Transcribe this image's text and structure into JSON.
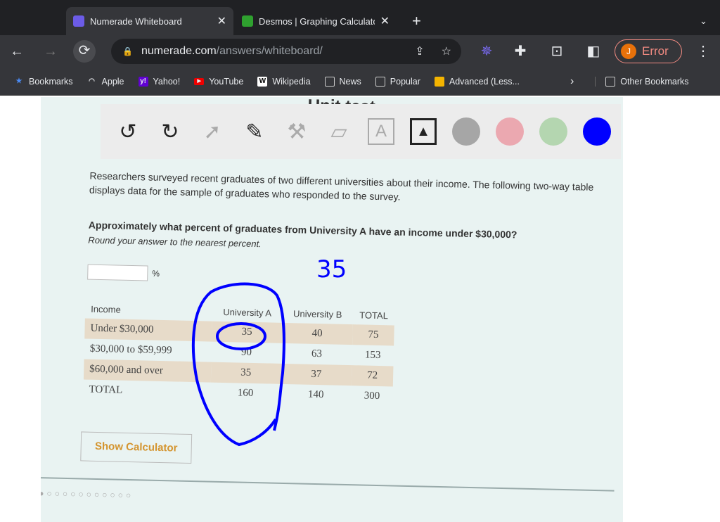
{
  "browser": {
    "tabs": [
      {
        "title": "Numerade Whiteboard",
        "active": true
      },
      {
        "title": "Desmos | Graphing Calculator",
        "active": false
      }
    ],
    "url_host": "numerade.com",
    "url_path": "/answers/whiteboard/",
    "profile": {
      "initial": "J",
      "label": "Error"
    },
    "bookmarks": [
      "Bookmarks",
      "Apple",
      "Yahoo!",
      "YouTube",
      "Wikipedia",
      "News",
      "Popular",
      "Advanced (Less..."
    ],
    "other_bookmarks": "Other Bookmarks"
  },
  "whiteboard": {
    "tools": [
      "undo",
      "redo",
      "pointer",
      "pen",
      "tools",
      "eraser",
      "text",
      "image"
    ],
    "colors": [
      "#a6a6a6",
      "#eba8b0",
      "#b4d6b0",
      "#0000ff"
    ],
    "heading_fragment": "Unit test",
    "handwritten_answer": "35"
  },
  "question": {
    "intro": "Researchers surveyed recent graduates of two different universities about their income. The following two-way table displays data for the sample of graduates who responded to the survey.",
    "prompt": "Approximately what percent of graduates from University A have an income under $30,000?",
    "hint": "Round your answer to the nearest percent.",
    "answer_value": "",
    "unit": "%",
    "table": {
      "headers": [
        "Income",
        "University A",
        "University B",
        "TOTAL"
      ],
      "rows": [
        [
          "Under $30,000",
          "35",
          "40",
          "75"
        ],
        [
          "$30,000 to $59,999",
          "90",
          "63",
          "153"
        ],
        [
          "$60,000 and over",
          "35",
          "37",
          "72"
        ],
        [
          "TOTAL",
          "160",
          "140",
          "300"
        ]
      ]
    },
    "calculator_button": "Show Calculator"
  }
}
